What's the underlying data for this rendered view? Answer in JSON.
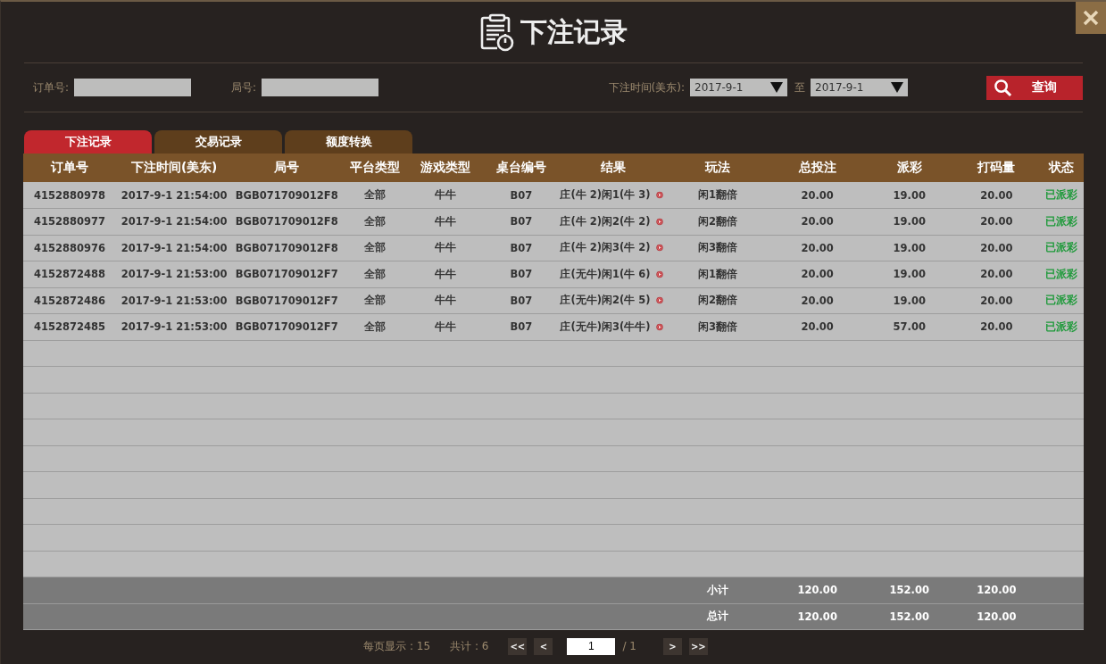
{
  "window": {
    "title": "下注记录"
  },
  "filters": {
    "order_label": "订单号:",
    "round_label": "局号:",
    "time_label": "下注时间(美东):",
    "date_from": "2017-9-1",
    "range_sep": "至",
    "date_to": "2017-9-1",
    "query_button": "查询"
  },
  "tabs": [
    {
      "label": "下注记录",
      "selected": true
    },
    {
      "label": "交易记录",
      "selected": false
    },
    {
      "label": "额度转换",
      "selected": false
    }
  ],
  "table": {
    "columns": [
      "订单号",
      "下注时间(美东)",
      "局号",
      "平台类型",
      "游戏类型",
      "桌台编号",
      "结果",
      "玩法",
      "总投注",
      "派彩",
      "打码量",
      "状态"
    ],
    "rows": [
      {
        "order": "4152880978",
        "time": "2017-9-1 21:54:00",
        "round": "BGB071709012F8",
        "platform": "全部",
        "game": "牛牛",
        "table": "B07",
        "result": "庄(牛 2)闲1(牛 3)",
        "play": "闲1翻倍",
        "bet": "20.00",
        "payout": "19.00",
        "rolling": "20.00",
        "status": "已派彩"
      },
      {
        "order": "4152880977",
        "time": "2017-9-1 21:54:00",
        "round": "BGB071709012F8",
        "platform": "全部",
        "game": "牛牛",
        "table": "B07",
        "result": "庄(牛 2)闲2(牛 2)",
        "play": "闲2翻倍",
        "bet": "20.00",
        "payout": "19.00",
        "rolling": "20.00",
        "status": "已派彩"
      },
      {
        "order": "4152880976",
        "time": "2017-9-1 21:54:00",
        "round": "BGB071709012F8",
        "platform": "全部",
        "game": "牛牛",
        "table": "B07",
        "result": "庄(牛 2)闲3(牛 2)",
        "play": "闲3翻倍",
        "bet": "20.00",
        "payout": "19.00",
        "rolling": "20.00",
        "status": "已派彩"
      },
      {
        "order": "4152872488",
        "time": "2017-9-1 21:53:00",
        "round": "BGB071709012F7",
        "platform": "全部",
        "game": "牛牛",
        "table": "B07",
        "result": "庄(无牛)闲1(牛 6)",
        "play": "闲1翻倍",
        "bet": "20.00",
        "payout": "19.00",
        "rolling": "20.00",
        "status": "已派彩"
      },
      {
        "order": "4152872486",
        "time": "2017-9-1 21:53:00",
        "round": "BGB071709012F7",
        "platform": "全部",
        "game": "牛牛",
        "table": "B07",
        "result": "庄(无牛)闲2(牛 5)",
        "play": "闲2翻倍",
        "bet": "20.00",
        "payout": "19.00",
        "rolling": "20.00",
        "status": "已派彩"
      },
      {
        "order": "4152872485",
        "time": "2017-9-1 21:53:00",
        "round": "BGB071709012F7",
        "platform": "全部",
        "game": "牛牛",
        "table": "B07",
        "result": "庄(无牛)闲3(牛牛)",
        "play": "闲3翻倍",
        "bet": "20.00",
        "payout": "57.00",
        "rolling": "20.00",
        "status": "已派彩"
      }
    ],
    "totals": [
      {
        "label": "小计",
        "bet": "120.00",
        "payout": "152.00",
        "rolling": "120.00"
      },
      {
        "label": "总计",
        "bet": "120.00",
        "payout": "152.00",
        "rolling": "120.00"
      }
    ]
  },
  "pagination": {
    "per_page": "每页显示 : 15",
    "total": "共计 : 6",
    "first": "<<",
    "prev": "<",
    "page": "1",
    "of": "/ 1",
    "next": ">",
    "last": ">>"
  }
}
